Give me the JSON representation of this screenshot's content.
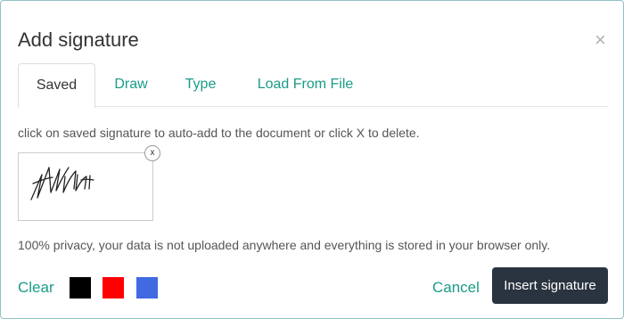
{
  "dialog": {
    "title": "Add signature",
    "close_glyph": "×"
  },
  "tabs": [
    {
      "label": "Saved",
      "active": true
    },
    {
      "label": "Draw",
      "active": false
    },
    {
      "label": "Type",
      "active": false
    },
    {
      "label": "Load From File",
      "active": false
    }
  ],
  "saved": {
    "hint": "click on saved signature to auto-add to the document or click X to delete.",
    "delete_glyph": "x",
    "privacy": "100% privacy, your data is not uploaded anywhere and everything is stored in your browser only."
  },
  "footer": {
    "clear_label": "Clear",
    "colors": [
      "#000000",
      "#ff0000",
      "#4169e1"
    ],
    "cancel_label": "Cancel",
    "insert_label": "Insert signature"
  },
  "theme": {
    "accent": "#1a9b87",
    "primary_button": "#2a3440"
  }
}
